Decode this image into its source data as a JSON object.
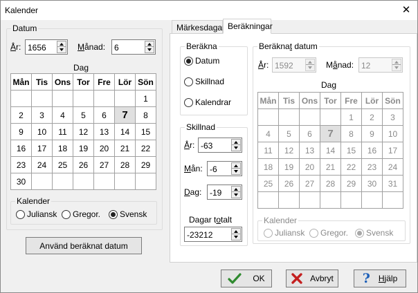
{
  "window": {
    "title": "Kalender",
    "close_glyph": "✕"
  },
  "left": {
    "group_label": "Datum",
    "year_label": "År:",
    "year_value": "1656",
    "month_label": "Månad:",
    "month_value": "6",
    "day_label": "Dag",
    "weekdays": [
      "Mån",
      "Tis",
      "Ons",
      "Tor",
      "Fre",
      "Lör",
      "Sön"
    ],
    "weeks": [
      [
        "",
        "",
        "",
        "",
        "",
        "",
        "1"
      ],
      [
        "2",
        "3",
        "4",
        "5",
        "6",
        "7",
        "8"
      ],
      [
        "9",
        "10",
        "11",
        "12",
        "13",
        "14",
        "15"
      ],
      [
        "16",
        "17",
        "18",
        "19",
        "20",
        "21",
        "22"
      ],
      [
        "23",
        "24",
        "25",
        "26",
        "27",
        "28",
        "29"
      ],
      [
        "30",
        "",
        "",
        "",
        "",
        "",
        ""
      ]
    ],
    "today": "7",
    "calendar_label": "Kalender",
    "calendar_options": [
      "Juliansk",
      "Gregor.",
      "Svensk"
    ],
    "calendar_selected": "Svensk",
    "apply_button": "Använd beräknat datum"
  },
  "tabs": [
    "Märkesdagar",
    "Beräkningar"
  ],
  "active_tab": "Beräkningar",
  "calc": {
    "group_label": "Beräkna",
    "options": [
      "Datum",
      "Skillnad",
      "Kalendrar"
    ],
    "selected": "Datum"
  },
  "diff": {
    "group_label": "Skillnad",
    "year_label": "År:",
    "year_value": "-63",
    "month_label": "Mån:",
    "month_value": "-6",
    "day_label": "Dag:",
    "day_value": "-19",
    "total_label": "Dagar totalt",
    "total_value": "-23212"
  },
  "result": {
    "group_label": "Beräknat datum",
    "year_label": "År:",
    "year_value": "1592",
    "month_label": "Månad:",
    "month_value": "12",
    "day_label": "Dag",
    "weekdays": [
      "Mån",
      "Tis",
      "Ons",
      "Tor",
      "Fre",
      "Lör",
      "Sön"
    ],
    "weeks": [
      [
        "",
        "",
        "",
        "",
        "1",
        "2",
        "3"
      ],
      [
        "4",
        "5",
        "6",
        "7",
        "8",
        "9",
        "10"
      ],
      [
        "11",
        "12",
        "13",
        "14",
        "15",
        "16",
        "17"
      ],
      [
        "18",
        "19",
        "20",
        "21",
        "22",
        "23",
        "24"
      ],
      [
        "25",
        "26",
        "27",
        "28",
        "29",
        "30",
        "31"
      ],
      [
        "",
        "",
        "",
        "",
        "",
        "",
        ""
      ]
    ],
    "today": "7",
    "calendar_label": "Kalender",
    "calendar_options": [
      "Juliansk",
      "Gregor.",
      "Svensk"
    ],
    "calendar_selected": "Svensk"
  },
  "footer": {
    "ok": "OK",
    "ok_icon": "check-icon",
    "cancel": "Avbryt",
    "cancel_icon": "x-icon",
    "help": "Hjälp",
    "help_icon": "question-icon"
  }
}
